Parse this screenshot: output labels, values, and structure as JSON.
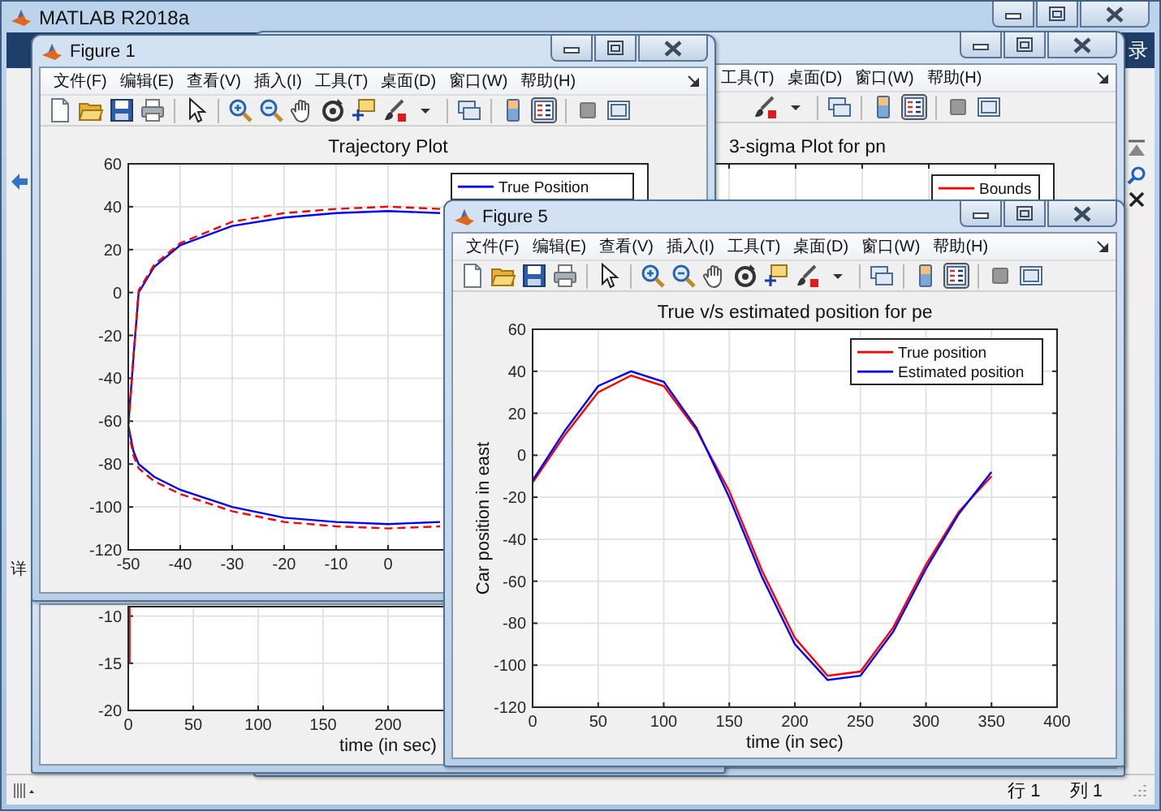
{
  "window": {
    "title": "MATLAB R2018a",
    "toolstrip_label": "录",
    "side_label": "详"
  },
  "figures": [
    {
      "kind": "window",
      "title": "Figure 1",
      "menus": [
        "文件(F)",
        "编辑(E)",
        "查看(V)",
        "插入(I)",
        "工具(T)",
        "桌面(D)",
        "窗口(W)",
        "帮助(H)"
      ],
      "chart_data": {
        "type": "line",
        "title": "Trajectory Plot",
        "grid": true,
        "legend": "upper right",
        "x": [
          10,
          0,
          -10,
          -20,
          -30,
          -40,
          -45,
          -48,
          -49,
          -50,
          -49,
          -48,
          -45,
          -40,
          -30,
          -20,
          -10,
          0,
          10
        ],
        "series": [
          {
            "name": "True Position",
            "color": "#0000ff",
            "line_style": "solid",
            "values": [
              37,
              38,
              37,
              35,
              31,
              22,
              12,
              0,
              -30,
              -62,
              -74,
              -80,
              -86,
              -92,
              -100,
              -105,
              -107,
              -108,
              -107
            ]
          },
          {
            "color": "#ff0000",
            "line_style": "dashed",
            "values": [
              39,
              40,
              39,
              37,
              33,
              23,
              13,
              1,
              -30,
              -64,
              -76,
              -82,
              -88,
              -94,
              -102,
              -107,
              -109,
              -110,
              -109
            ]
          }
        ],
        "xlim": [
          -50,
          50
        ],
        "ylim": [
          -120,
          60
        ],
        "xticks": [
          -50,
          -40,
          -30,
          -20,
          -10,
          0
        ],
        "yticks": [
          -120,
          -100,
          -80,
          -60,
          -40,
          -20,
          0,
          20,
          40,
          60
        ]
      }
    },
    {
      "kind": "window",
      "menus": [
        "工具(T)",
        "桌面(D)",
        "窗口(W)",
        "帮助(H)"
      ],
      "plot_title": "3-sigma Plot for pn",
      "legend": [
        {
          "label": "Bounds",
          "color": "#ff0000"
        }
      ]
    },
    {
      "kind": "pane",
      "chart_data": {
        "type": "line",
        "xlabel": "time (in sec)",
        "grid": true,
        "x": [
          1,
          1
        ],
        "series": [
          {
            "color": "#ff0000",
            "line_style": "solid",
            "values": [
              -15,
              -9
            ]
          }
        ],
        "xlim": [
          0,
          400
        ],
        "ylim": [
          -20,
          -9
        ],
        "xticks": [
          0,
          50,
          100,
          150,
          200
        ],
        "yticks": [
          -20,
          -15,
          -10
        ]
      }
    },
    {
      "kind": "window",
      "title": "Figure 5",
      "menus": [
        "文件(F)",
        "编辑(E)",
        "查看(V)",
        "插入(I)",
        "工具(T)",
        "桌面(D)",
        "窗口(W)",
        "帮助(H)"
      ],
      "chart_data": {
        "type": "line",
        "title": "True v/s estimated position for pe",
        "xlabel": "time (in sec)",
        "ylabel": "Car position in east",
        "grid": true,
        "legend": "upper right",
        "x": [
          0,
          25,
          50,
          75,
          100,
          125,
          150,
          175,
          200,
          225,
          250,
          275,
          300,
          325,
          350
        ],
        "series": [
          {
            "name": "True position",
            "color": "#ff0000",
            "line_style": "solid",
            "values": [
              -13,
              10,
              30,
              38,
              33,
              12,
              -17,
              -55,
              -87,
              -105,
              -103,
              -82,
              -52,
              -27,
              -10
            ]
          },
          {
            "name": "Estimated position",
            "color": "#0000ff",
            "line_style": "solid",
            "values": [
              -12,
              12,
              33,
              40,
              35,
              13,
              -20,
              -58,
              -90,
              -107,
              -105,
              -84,
              -54,
              -28,
              -8
            ]
          }
        ],
        "xlim": [
          0,
          400
        ],
        "ylim": [
          -120,
          60
        ],
        "xticks": [
          0,
          50,
          100,
          150,
          200,
          250,
          300,
          350,
          400
        ],
        "yticks": [
          -120,
          -100,
          -80,
          -60,
          -40,
          -20,
          0,
          20,
          40,
          60
        ]
      }
    }
  ],
  "status_bar": {
    "row": "行 1",
    "column": "列 1"
  }
}
